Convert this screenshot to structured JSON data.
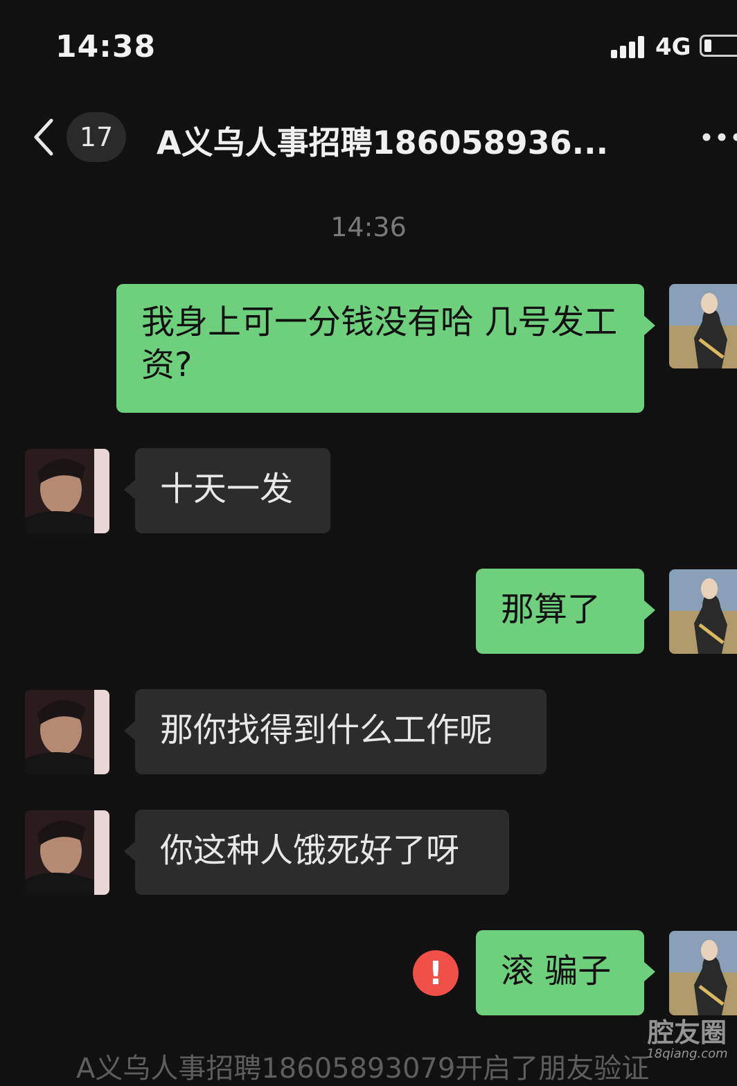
{
  "status_bar": {
    "time": "14:38",
    "network": "4G"
  },
  "nav": {
    "unread_count": "17",
    "title": "A义乌人事招聘186058936..."
  },
  "time_divider": "14:36",
  "messages": [
    {
      "side": "out",
      "text": "我身上可一分钱没有哈 几号发工资?"
    },
    {
      "side": "in",
      "text": "十天一发"
    },
    {
      "side": "out",
      "text": "那算了"
    },
    {
      "side": "in",
      "text": "那你找得到什么工作呢"
    },
    {
      "side": "in",
      "text": "你这种人饿死好了呀"
    },
    {
      "side": "out",
      "text": "滚 骗子",
      "send_failed": true
    }
  ],
  "watermark": {
    "main": "腔友圈",
    "sub": "18qiang.com"
  },
  "system_tip": "A义乌人事招聘18605893079开启了朋友验证",
  "colors": {
    "background": "#111111",
    "outgoing_bubble": "#6ecf7c",
    "incoming_bubble": "#2c2c2c",
    "error": "#f05048"
  }
}
